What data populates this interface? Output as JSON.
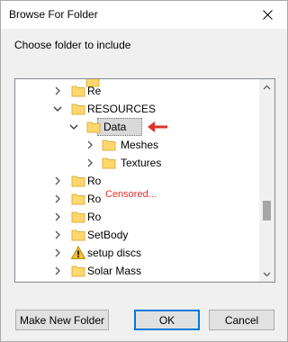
{
  "dialog": {
    "title": "Browse For Folder",
    "prompt": "Choose folder to include"
  },
  "tree": {
    "items": [
      {
        "label": "Re",
        "expanded": false,
        "icon": "folder-icon"
      },
      {
        "label": "RESOURCES",
        "expanded": true,
        "icon": "folder-icon"
      },
      {
        "label": "Data",
        "expanded": true,
        "selected": true,
        "icon": "folder-icon"
      },
      {
        "label": "Meshes",
        "expanded": false,
        "icon": "folder-icon"
      },
      {
        "label": "Textures",
        "expanded": false,
        "icon": "folder-icon"
      },
      {
        "label": "Ro",
        "expanded": false,
        "icon": "folder-icon"
      },
      {
        "label": "Ro",
        "expanded": false,
        "icon": "folder-icon"
      },
      {
        "label": "Ro",
        "expanded": false,
        "icon": "folder-icon"
      },
      {
        "label": "SetBody",
        "expanded": false,
        "icon": "folder-icon"
      },
      {
        "label": "setup discs",
        "expanded": false,
        "icon": "warning-icon"
      },
      {
        "label": "Solar Mass",
        "expanded": false,
        "icon": "folder-icon"
      }
    ],
    "annotation": "Censored..."
  },
  "buttons": {
    "make_new_folder": "Make New Folder",
    "ok": "OK",
    "cancel": "Cancel"
  },
  "colors": {
    "accent": "#0078d7",
    "annotation": "#e0302a",
    "folder": "#ffd76e"
  }
}
